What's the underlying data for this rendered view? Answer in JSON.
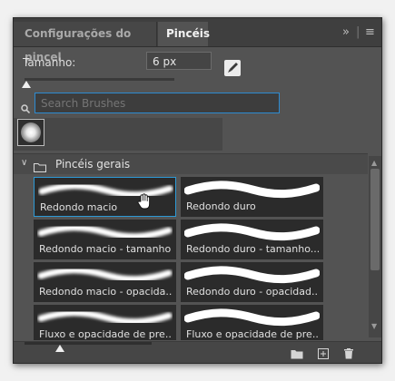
{
  "tabs": [
    {
      "label": "Configurações do pincel",
      "active": false
    },
    {
      "label": "Pincéis",
      "active": true
    }
  ],
  "tabbar_controls": {
    "collapse_glyph": "»",
    "separator": "|",
    "menu_glyph": "≡"
  },
  "size": {
    "label": "Tamanho:",
    "value": "6 px",
    "slider_fraction": 0.01
  },
  "search": {
    "placeholder": "Search Brushes",
    "value": ""
  },
  "group": {
    "title": "Pincéis gerais",
    "expanded": true
  },
  "brushes": [
    {
      "label": "Redondo macio",
      "kind": "soft",
      "selected": true
    },
    {
      "label": "Redondo duro",
      "kind": "hard",
      "selected": false
    },
    {
      "label": "Redondo macio - tamanho...",
      "kind": "soft",
      "selected": false
    },
    {
      "label": "Redondo duro - tamanho...",
      "kind": "hard",
      "selected": false
    },
    {
      "label": "Redondo macio - opacida...",
      "kind": "soft",
      "selected": false
    },
    {
      "label": "Redondo duro - opacidad...",
      "kind": "hard",
      "selected": false
    },
    {
      "label": "Fluxo e opacidade de pre...",
      "kind": "soft",
      "selected": false
    },
    {
      "label": "Fluxo e opacidade de pre...",
      "kind": "hard",
      "selected": false
    }
  ],
  "icons": {
    "edit": "brush-edit-icon",
    "search": "search-icon",
    "folder": "folder-icon",
    "new_group": "new-group-folder-icon",
    "new_brush": "new-brush-icon",
    "delete": "trash-icon",
    "pointer": "hand-cursor-icon"
  },
  "colors": {
    "accent": "#2d9ad6",
    "panel": "#535353",
    "tile": "#2b2b2b"
  },
  "zoom_fraction": 0.28
}
